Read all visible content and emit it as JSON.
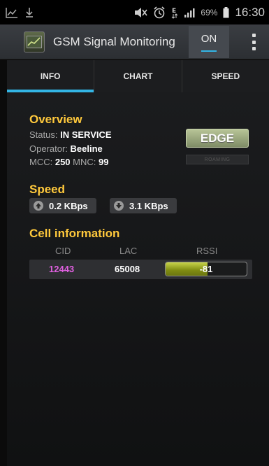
{
  "status_bar": {
    "battery_percent": "69%",
    "time": "16:30",
    "icons": [
      "chart-notification-icon",
      "download-icon",
      "mute-icon",
      "alarm-icon",
      "data-e-icon",
      "signal-icon",
      "battery-icon"
    ]
  },
  "action_bar": {
    "title": "GSM Signal Monitoring",
    "on_label": "ON",
    "logo_icon": "app-chart-icon"
  },
  "tabs": [
    {
      "label": "INFO",
      "active": true
    },
    {
      "label": "CHART",
      "active": false
    },
    {
      "label": "SPEED",
      "active": false
    }
  ],
  "overview": {
    "title": "Overview",
    "status_label": "Status:",
    "status_value": "IN SERVICE",
    "operator_label": "Operator:",
    "operator_value": "Beeline",
    "mcc_label": "MCC:",
    "mcc_value": "250",
    "mnc_label": "MNC:",
    "mnc_value": "99",
    "network_type": "EDGE",
    "roaming_label": "ROAMING"
  },
  "speed": {
    "title": "Speed",
    "upload": "0.2 KBps",
    "download": "3.1 KBps"
  },
  "cell_info": {
    "title": "Cell information",
    "headers": [
      "CID",
      "LAC",
      "RSSI"
    ],
    "cid": "12443",
    "lac": "65008",
    "rssi": "-81",
    "rssi_level_percent": 52
  },
  "colors": {
    "accent": "#33b5e5",
    "section_title": "#ffc93c",
    "cid": "#e060e0"
  }
}
